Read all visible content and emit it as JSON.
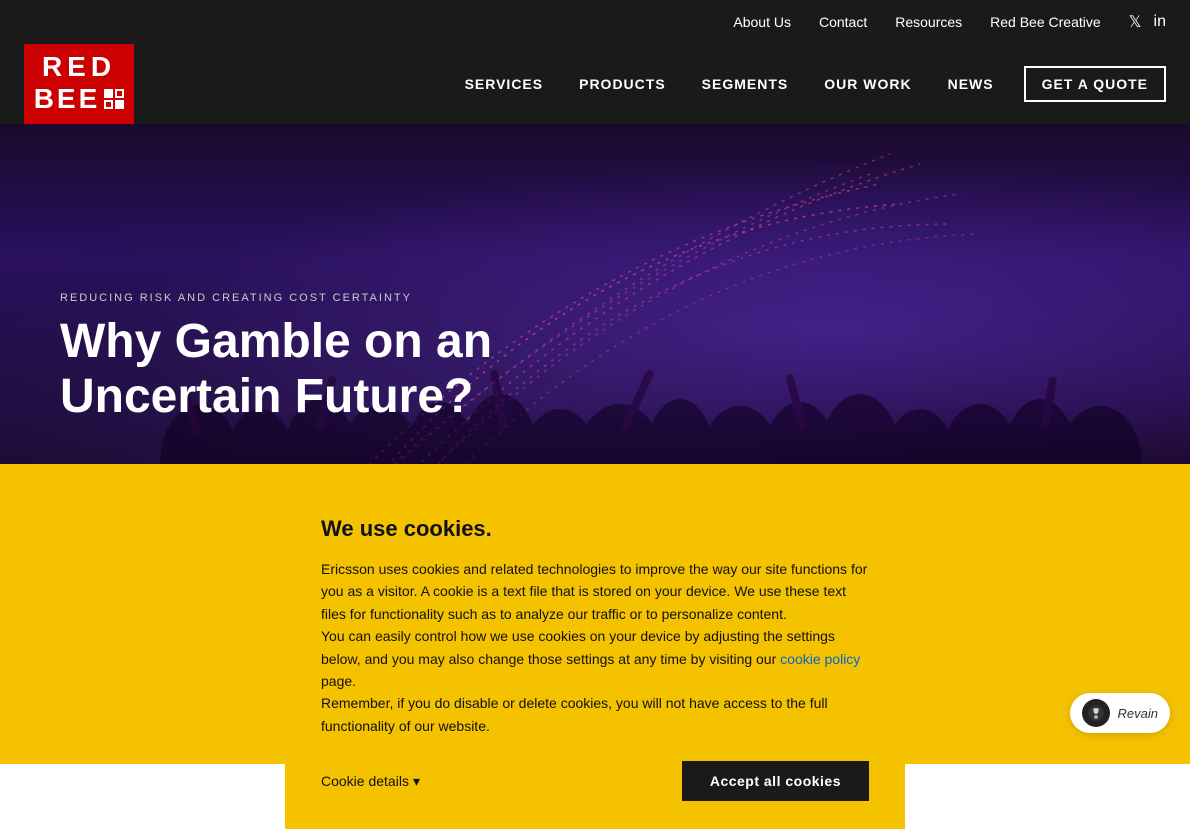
{
  "topNav": {
    "links": [
      {
        "label": "About Us",
        "id": "about-us"
      },
      {
        "label": "Contact",
        "id": "contact"
      },
      {
        "label": "Resources",
        "id": "resources"
      },
      {
        "label": "Red Bee Creative",
        "id": "red-bee-creative"
      }
    ],
    "social": [
      {
        "icon": "twitter",
        "symbol": "𝕏"
      },
      {
        "icon": "linkedin",
        "symbol": "in"
      }
    ]
  },
  "mainNav": {
    "logo": {
      "line1": "RED",
      "line2": "BEE"
    },
    "links": [
      {
        "label": "SERVICES",
        "id": "services"
      },
      {
        "label": "PRODUCTS",
        "id": "products"
      },
      {
        "label": "SEGMENTS",
        "id": "segments"
      },
      {
        "label": "OUR WORK",
        "id": "our-work"
      },
      {
        "label": "NEWS",
        "id": "news"
      }
    ],
    "cta": "GET A QUOTE"
  },
  "hero": {
    "subtitle": "REDUCING RISK AND CREATING COST CERTAINTY",
    "title_line1": "Why Gamble on an",
    "title_line2": "Uncertain Future?"
  },
  "cookie": {
    "title": "We use cookies.",
    "body": "Ericsson uses cookies and related technologies to improve the way our site functions for you as a visitor. A cookie is a text file that is stored on your device. We use these text files for functionality such as to analyze our traffic or to personalize content.\nYou can easily control how we use cookies on your device by adjusting the settings below, and you may also change those settings at any time by visiting our ",
    "link_text": "cookie policy",
    "body_end": " page.\nRemember, if you do disable or delete cookies, you will not have access to the full functionality of our website.",
    "details_label": "Cookie details",
    "accept_label": "Accept all cookies"
  },
  "revain": {
    "label": "Revain"
  }
}
